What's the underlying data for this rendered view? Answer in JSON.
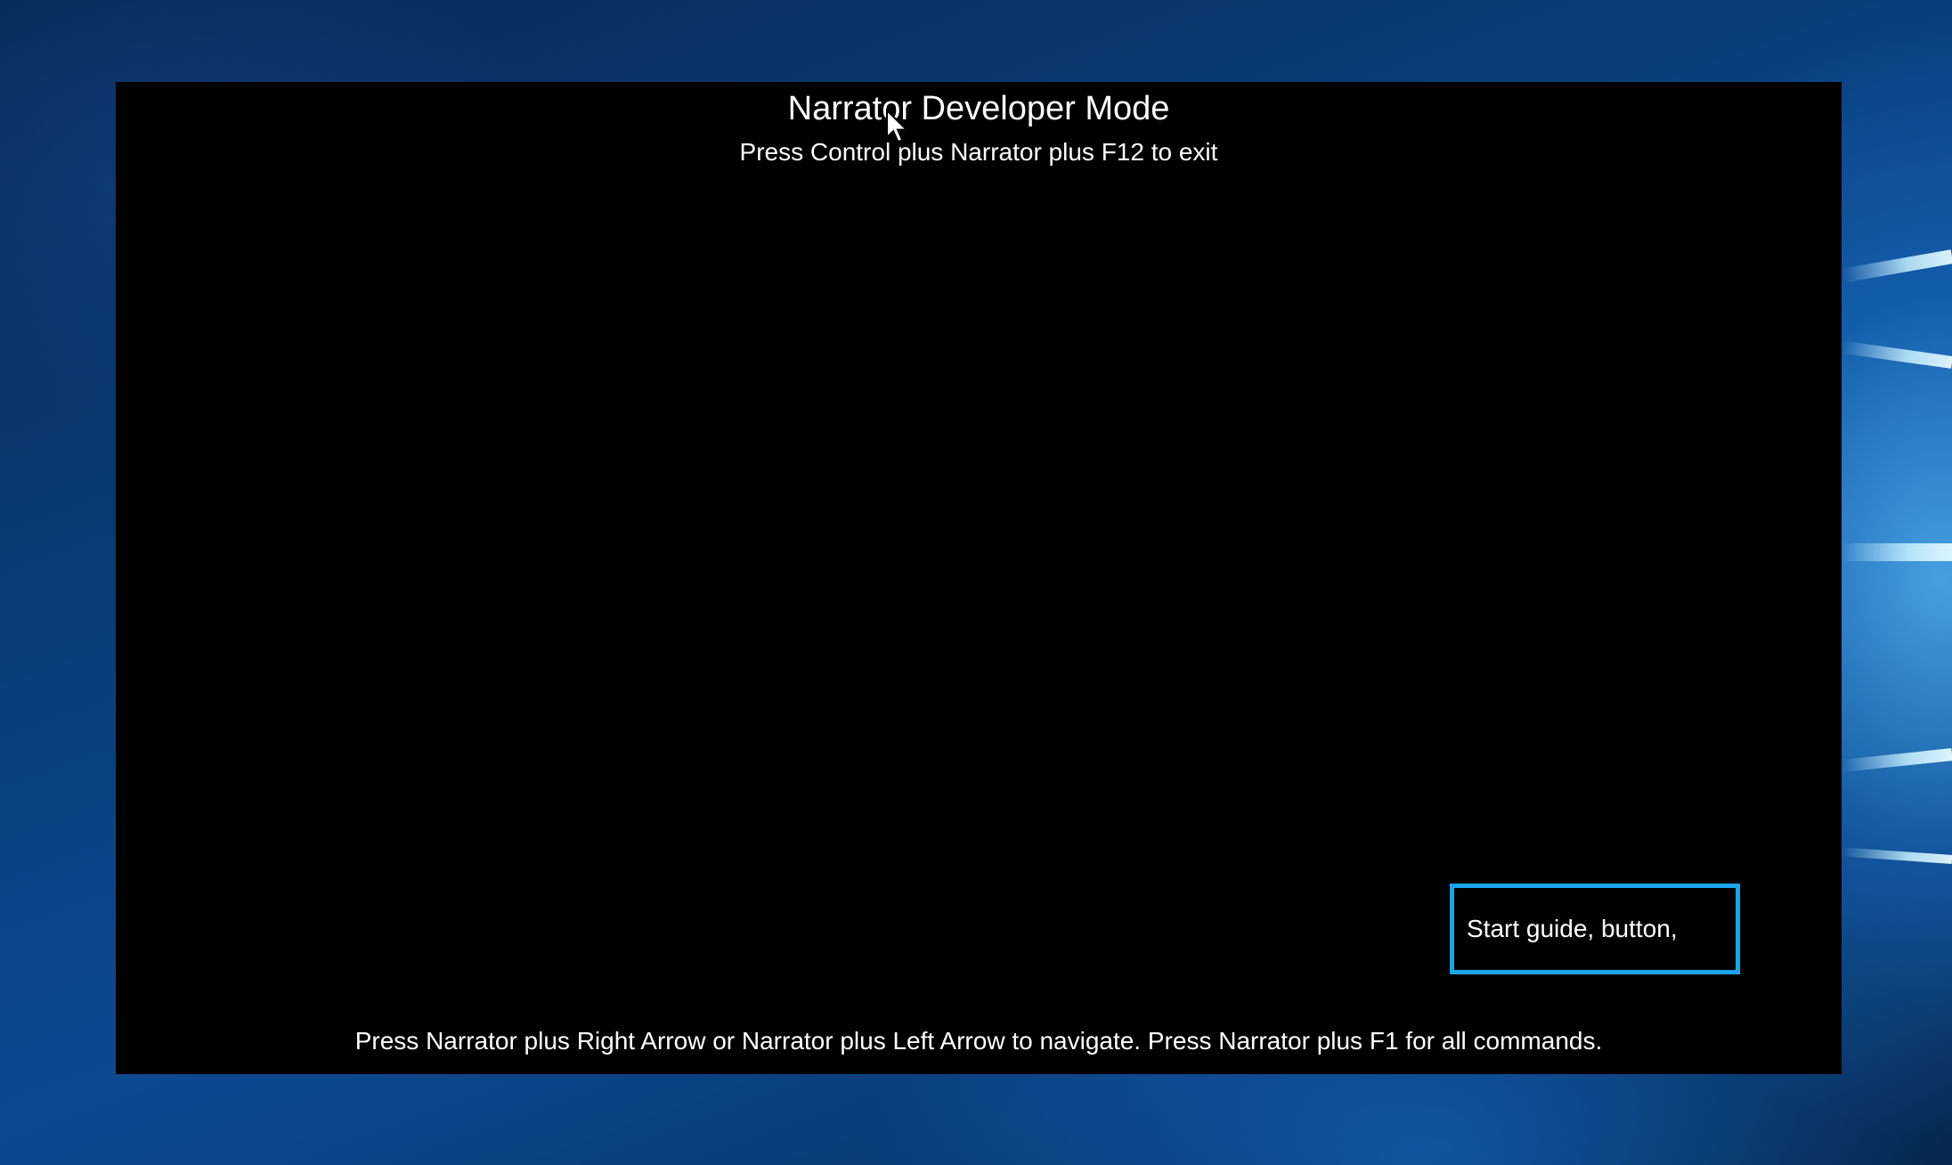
{
  "desktop": {
    "accent_color": "#0b4a90"
  },
  "narrator_overlay": {
    "title": "Narrator Developer Mode",
    "subtitle": "Press Control plus Narrator plus F12 to exit",
    "focused_element": {
      "label": "Start guide, button,",
      "border_color": "#1aa3e8"
    },
    "footer": "Press Narrator plus Right Arrow or Narrator plus Left Arrow to navigate. Press Narrator plus F1 for all commands."
  },
  "icons": {
    "cursor": "mouse-pointer-icon"
  }
}
